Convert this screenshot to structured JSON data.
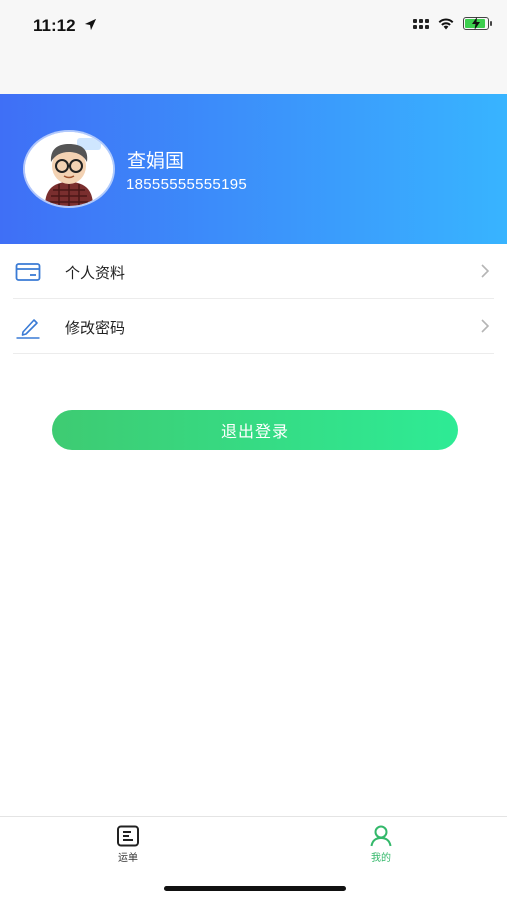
{
  "status_bar": {
    "time": "11:12",
    "icons": [
      "location-arrow-icon",
      "cellular-signal-icon",
      "wifi-icon",
      "battery-charging-icon"
    ],
    "battery_color": "#3ccf4e"
  },
  "profile": {
    "name": "查娟国",
    "phone": "18555555555195",
    "gradient": [
      "#3f6ff6",
      "#38b4ff"
    ]
  },
  "menu": {
    "items": [
      {
        "label": "个人资料",
        "icon": "card-icon"
      },
      {
        "label": "修改密码",
        "icon": "pencil-icon"
      }
    ]
  },
  "logout": {
    "label": "退出登录",
    "gradient": [
      "#3ecb72",
      "#2eeb95"
    ]
  },
  "tab_bar": {
    "tabs": [
      {
        "label": "运单",
        "icon": "document-list-icon",
        "active": false
      },
      {
        "label": "我的",
        "icon": "person-icon",
        "active": true
      }
    ],
    "active_color": "#33b86a"
  }
}
